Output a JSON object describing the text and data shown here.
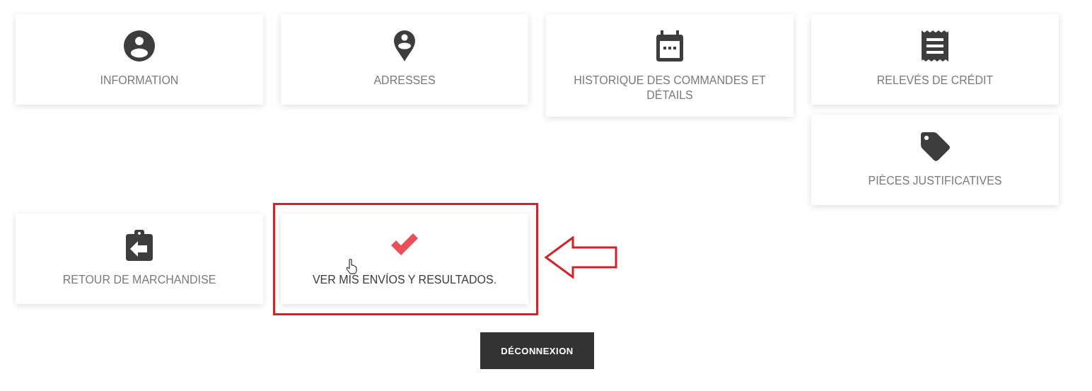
{
  "top_columns": [
    {
      "tiles": [
        {
          "label": "INFORMATION",
          "kind": "person",
          "color": "#3d3d3d",
          "hovered": false
        }
      ]
    },
    {
      "tiles": [
        {
          "label": "ADRESSES",
          "kind": "pin",
          "color": "#3d3d3d",
          "hovered": false
        }
      ]
    },
    {
      "tiles": [
        {
          "label": "HISTORIQUE DES COMMANDES ET DÉTAILS",
          "kind": "calendar",
          "color": "#3d3d3d",
          "hovered": false
        }
      ]
    },
    {
      "tiles": [
        {
          "label": "RELEVÉS DE CRÉDIT",
          "kind": "receipt",
          "color": "#3d3d3d",
          "hovered": false
        },
        {
          "label": "PIÈCES JUSTIFICATIVES",
          "kind": "tag",
          "color": "#3d3d3d",
          "hovered": false
        }
      ]
    }
  ],
  "bottom_row": [
    {
      "label": "RETOUR DE MARCHANDISE",
      "kind": "clipboard",
      "color": "#3d3d3d",
      "hovered": false
    },
    {
      "label": "VER MIS ENVÍOS Y RESULTADOS.",
      "kind": "check",
      "color": "#e8505b",
      "hovered": true,
      "highlighted": true
    }
  ],
  "logout_button": "DÉCONNEXION"
}
